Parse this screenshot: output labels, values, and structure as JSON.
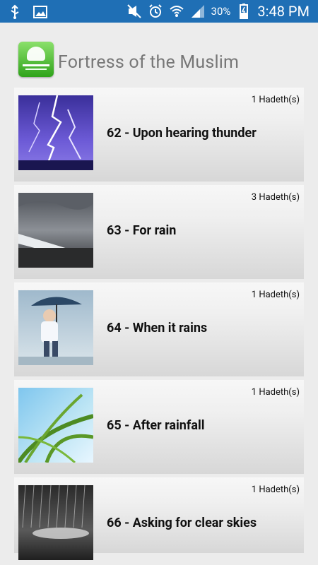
{
  "status_bar": {
    "battery": "30%",
    "time": "3:48 PM",
    "icons": [
      "usb-icon",
      "image-icon",
      "mute-icon",
      "alarm-icon",
      "wifi-icon",
      "signal-icon",
      "battery-icon"
    ]
  },
  "app": {
    "title": "Fortress of the Muslim",
    "logo_icon": "mosque-logo-icon"
  },
  "items": [
    {
      "count": "1 Hadeth(s)",
      "title": "62 - Upon hearing thunder",
      "thumbnail": "lightning-image"
    },
    {
      "count": "3 Hadeth(s)",
      "title": "63 - For rain",
      "thumbnail": "storm-clouds-image"
    },
    {
      "count": "1 Hadeth(s)",
      "title": "64 - When it rains",
      "thumbnail": "child-with-umbrella-image"
    },
    {
      "count": "1 Hadeth(s)",
      "title": "65 - After rainfall",
      "thumbnail": "wet-grass-image"
    },
    {
      "count": "1 Hadeth(s)",
      "title": "66 - Asking for clear skies",
      "thumbnail": "heavy-rain-image"
    }
  ],
  "colors": {
    "status_bar_bg": "#1f6fb5",
    "background": "#ececec",
    "title_text": "#777777"
  }
}
